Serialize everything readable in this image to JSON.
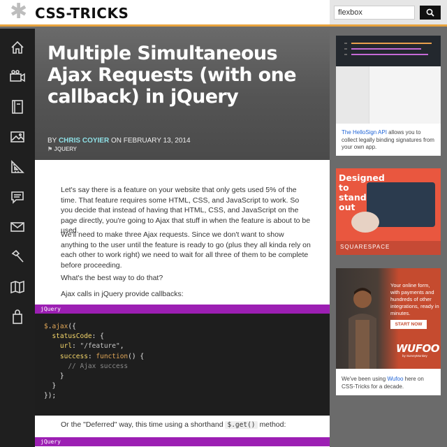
{
  "header": {
    "logo_text": "CSS-TRICKS",
    "search_value": "flexbox",
    "search_icon": "search-icon"
  },
  "nav": {
    "items": [
      {
        "name": "home",
        "icon": "home-icon"
      },
      {
        "name": "videos",
        "icon": "video-icon"
      },
      {
        "name": "almanac",
        "icon": "book-icon"
      },
      {
        "name": "snippets",
        "icon": "image-icon"
      },
      {
        "name": "guides",
        "icon": "ruler-triangle-icon"
      },
      {
        "name": "forums",
        "icon": "chat-icon"
      },
      {
        "name": "newsletter",
        "icon": "mail-icon"
      },
      {
        "name": "jobs",
        "icon": "hammer-icon"
      },
      {
        "name": "map",
        "icon": "map-icon"
      },
      {
        "name": "store",
        "icon": "bag-icon"
      }
    ]
  },
  "article": {
    "title": "Multiple Simultaneous Ajax Requests (with one callback) in jQuery",
    "by": "BY",
    "author": "CHRIS COYIER",
    "on_date": "ON FEBRUARY 13, 2014",
    "tag": "JQUERY",
    "paragraphs": [
      "Let's say there is a feature on your website that only gets used 5% of the time. That feature requires some HTML, CSS, and JavaScript to work. So you decide that instead of having that HTML, CSS, and JavaScript on the page directly, you're going to Ajax that stuff in when the feature is about to be used.",
      "We'll need to make three Ajax requests. Since we don't want to show anything to the user until the feature is ready to go (plus they all kinda rely on each other to work right) we need to wait for all three of them to be complete before proceeding.",
      "What's the best way to do that?",
      "Ajax calls in jQuery provide callbacks:"
    ],
    "code_lang": "jQuery",
    "code_lines": [
      "$.ajax({",
      "  statusCode: {",
      "    url: \"/feature\",",
      "    success: function() {",
      "      // Ajax success",
      "    }",
      "  }",
      "});"
    ],
    "deferred_text_before": "Or the \"Deferred\" way, this time using a shorthand",
    "deferred_code": "$.get()",
    "deferred_text_after": "method:",
    "code_lang_2": "jQuery"
  },
  "ads": {
    "hellosign": {
      "link_text": "The HelloSign API",
      "text": "allows you to collect legally binding signatures from your own app."
    },
    "squarespace": {
      "headline": "Designed to stand out",
      "brand": "SQUARESPACE"
    },
    "wufoo": {
      "copy": "Your online form, with payments and hundreds of other integrations, ready in minutes.",
      "cta": "START NOW",
      "brand": "WUFOO",
      "sub": "by SurveyMonkey",
      "caption_before": "We've been using",
      "caption_link": "Wufoo",
      "caption_after": "here on CSS-Tricks for a decade."
    }
  },
  "colors": {
    "accent": "#e8a33d",
    "code_bar": "#9c1fb3",
    "author": "#8ee0e6"
  }
}
